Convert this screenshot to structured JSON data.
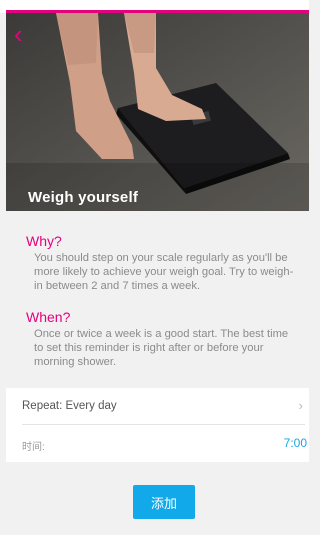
{
  "header": {
    "accent_color": "#e5007e",
    "back_icon": "chevron-left-icon",
    "title": "Weigh yourself"
  },
  "why": {
    "title": "Why?",
    "body": "You should step on your scale regularly as you'll be more likely to achieve your weigh goal. Try to weigh-in between 2 and 7 times a week."
  },
  "when": {
    "title": "When?",
    "body": "Once or twice a week is a good start. The best time to set this reminder is right after or before your morning shower."
  },
  "settings": {
    "repeat_label": "Repeat: Every day",
    "repeat_icon": "chevron-right-icon",
    "time_label": "时间:",
    "time_value": "7:00"
  },
  "actions": {
    "add_label": "添加",
    "add_color": "#11a9e9"
  }
}
